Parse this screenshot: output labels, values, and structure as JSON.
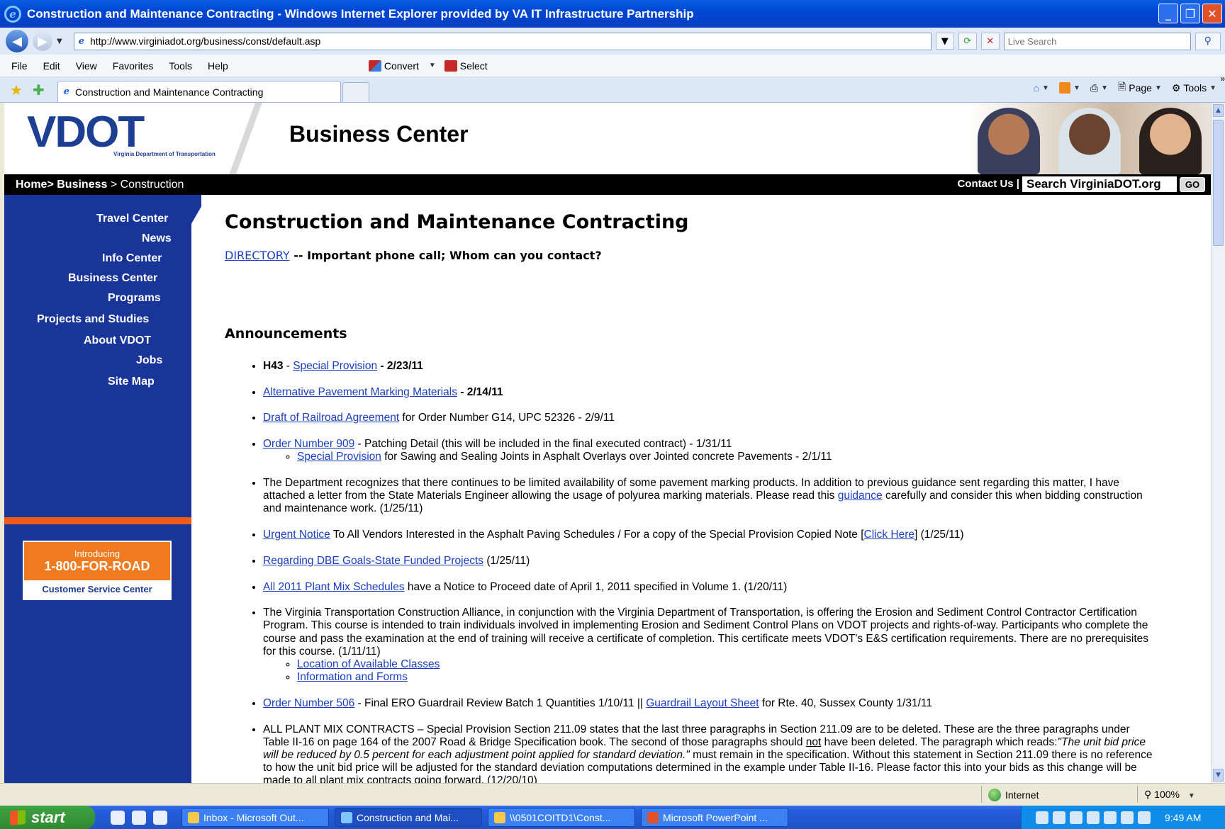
{
  "window": {
    "title": "Construction and Maintenance Contracting - Windows Internet Explorer provided by VA IT Infrastructure Partnership"
  },
  "address": {
    "url": "http://www.virginiadot.org/business/const/default.asp",
    "search_placeholder": "Live Search"
  },
  "menu": {
    "items": [
      "File",
      "Edit",
      "View",
      "Favorites",
      "Tools",
      "Help"
    ],
    "convert": "Convert",
    "select": "Select"
  },
  "tab": {
    "label": "Construction and Maintenance Contracting"
  },
  "command_bar": {
    "page": "Page",
    "tools": "Tools"
  },
  "site": {
    "logo_text": "VDOT",
    "logo_sub": "Virginia Department of Transportation",
    "header_title": "Business Center",
    "breadcrumb": {
      "home": "Home",
      "business": "Business",
      "current": "Construction"
    },
    "contact": "Contact Us |",
    "search_value": "Search VirginiaDOT.org",
    "go": "GO"
  },
  "sidebar": {
    "items": [
      "Travel Center",
      "News",
      "Info Center",
      "Business Center",
      "Programs",
      "Projects and Studies",
      "About VDOT",
      "Jobs",
      "Site Map"
    ],
    "promo": {
      "intro": "Introducing",
      "phone": "1-800-FOR-ROAD",
      "center": "Customer Service Center"
    }
  },
  "main": {
    "title": "Construction and Maintenance Contracting",
    "directory_link": "DIRECTORY",
    "directory_text": " -- Important phone call; Whom can you contact?",
    "announcements_heading": "Announcements",
    "a1": {
      "prefix": "H43",
      "sep": " - ",
      "link": "Special Provision",
      "date": " - 2/23/11"
    },
    "a2": {
      "link": "Alternative Pavement Marking Materials",
      "date": " - 2/14/11"
    },
    "a3": {
      "link": "Draft of Railroad Agreement",
      "text": " for Order Number G14, UPC 52326 - 2/9/11"
    },
    "a4": {
      "link": "Order Number 909",
      "text": " - Patching Detail (this will be included in the final executed contract) - 1/31/11",
      "sub_link": "Special Provision",
      "sub_text": " for Sawing and Sealing Joints in Asphalt Overlays over Jointed concrete Pavements - 2/1/11"
    },
    "a5": {
      "text1": "The Department recognizes that there continues to be limited availability of some pavement marking products. In addition to previous guidance sent regarding this matter, I have attached a letter from the State Materials Engineer allowing the usage of polyurea marking materials. Please read this ",
      "link": "guidance",
      "text2": " carefully and consider this when bidding construction and maintenance work. (1/25/11)"
    },
    "a6": {
      "link": "Urgent Notice",
      "text1": " To All Vendors Interested in the Asphalt Paving Schedules / For a copy of the Special Provision Copied Note [",
      "link2": "Click Here",
      "text2": "] (1/25/11)"
    },
    "a7": {
      "link": "Regarding DBE Goals-State Funded Projects",
      "text": "  (1/25/11)"
    },
    "a8": {
      "link": "All 2011 Plant Mix Schedules",
      "text": " have a Notice to Proceed date of April 1, 2011 specified in Volume 1. (1/20/11)"
    },
    "a9": {
      "text": "The Virginia Transportation Construction Alliance, in conjunction with the Virginia Department of Transportation, is offering the Erosion and Sediment Control Contractor Certification Program. This course is intended to train individuals involved in implementing Erosion and Sediment Control Plans on VDOT projects and rights-of-way.  Participants who complete the course and pass the examination at the end of training will receive a certificate of completion.  This certificate meets VDOT's E&S certification requirements.  There are no prerequisites for this course. (1/11/11)",
      "sub1": "Location of Available Classes",
      "sub2": "Information and Forms"
    },
    "a10": {
      "link": "Order Number 506",
      "text1": " - Final ERO Guardrail Review Batch 1 Quantities 1/10/11 || ",
      "link2": "Guardrail Layout Sheet",
      "text2": " for Rte. 40, Sussex County 1/31/11"
    },
    "a11": {
      "text1": "ALL PLANT MIX CONTRACTS – Special Provision Section 211.09 states that the last three paragraphs in Section 211.09 are to be deleted. These are the three paragraphs under Table II-16 on page 164 of the 2007 Road & Bridge Specification book. The second of those paragraphs should ",
      "not": "not",
      "text2": " have been deleted. The paragraph which reads:",
      "quote": "\"The unit bid price will be reduced by 0.5 percent for each adjustment point applied for standard deviation.\"",
      "text3": "  must remain in the specification. Without this statement in Section 211.09 there is no reference to how the unit bid price will be adjusted for the standard deviation computations determined in the example under Table II-16. Please factor this into your bids as this change will be made to all plant mix contracts going forward. (12/20/10)"
    }
  },
  "status": {
    "zone": "Internet",
    "zoom": "100%"
  },
  "taskbar": {
    "start": "start",
    "tasks": [
      "Inbox - Microsoft Out...",
      "Construction and Mai...",
      "\\\\0501COITD1\\Const...",
      "Microsoft PowerPoint ..."
    ],
    "clock": "9:49 AM"
  }
}
